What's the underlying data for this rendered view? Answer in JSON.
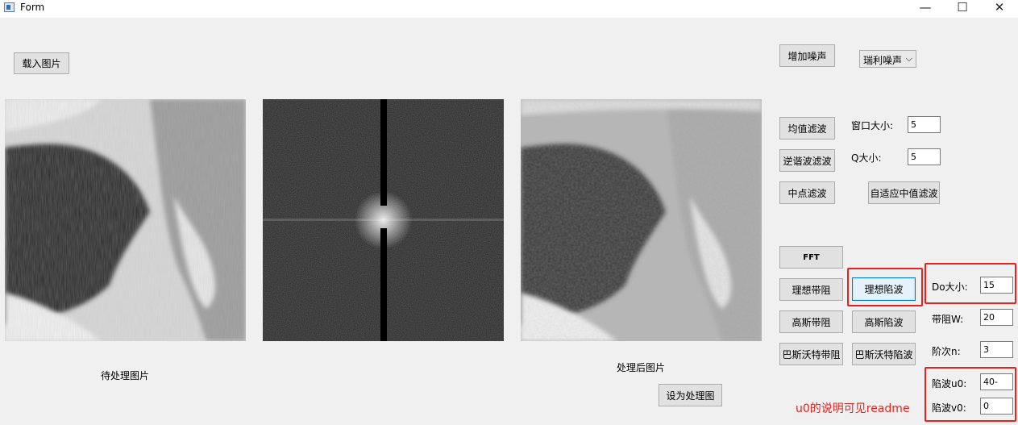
{
  "window": {
    "title": "Form",
    "minimize": "—",
    "maximize": "☐",
    "close": "✕"
  },
  "buttons": {
    "load_image": "载入图片",
    "add_noise": "增加噪声",
    "mean_filter": "均值滤波",
    "contraharmonic_filter": "逆谐波滤波",
    "midpoint_filter": "中点滤波",
    "adaptive_median_filter": "自适应中值滤波",
    "fft": "FFT",
    "ideal_bandstop": "理想带阻",
    "ideal_notch": "理想陷波",
    "gauss_bandstop": "高斯带阻",
    "gauss_notch": "高斯陷波",
    "butterworth_bandstop": "巴斯沃特带阻",
    "butterworth_notch": "巴斯沃特陷波",
    "set_as_source": "设为处理图"
  },
  "noise_select": {
    "value": "瑞利噪声"
  },
  "labels": {
    "original_caption": "待处理图片",
    "processed_caption": "处理后图片",
    "window_size": "窗口大小:",
    "q_size": "Q大小:",
    "d0_size": "Do大小:",
    "band_width": "带阻W:",
    "order": "阶次n:",
    "notch_u0": "陷波u0:",
    "notch_v0": "陷波v0:"
  },
  "inputs": {
    "window_size": "5",
    "q_size": "5",
    "d0_size": "15",
    "band_width": "20",
    "order": "3",
    "notch_u0": "40-",
    "notch_v0": "0"
  },
  "annotation": {
    "note": "u0的说明可见readme",
    "color": "#e8231f"
  }
}
